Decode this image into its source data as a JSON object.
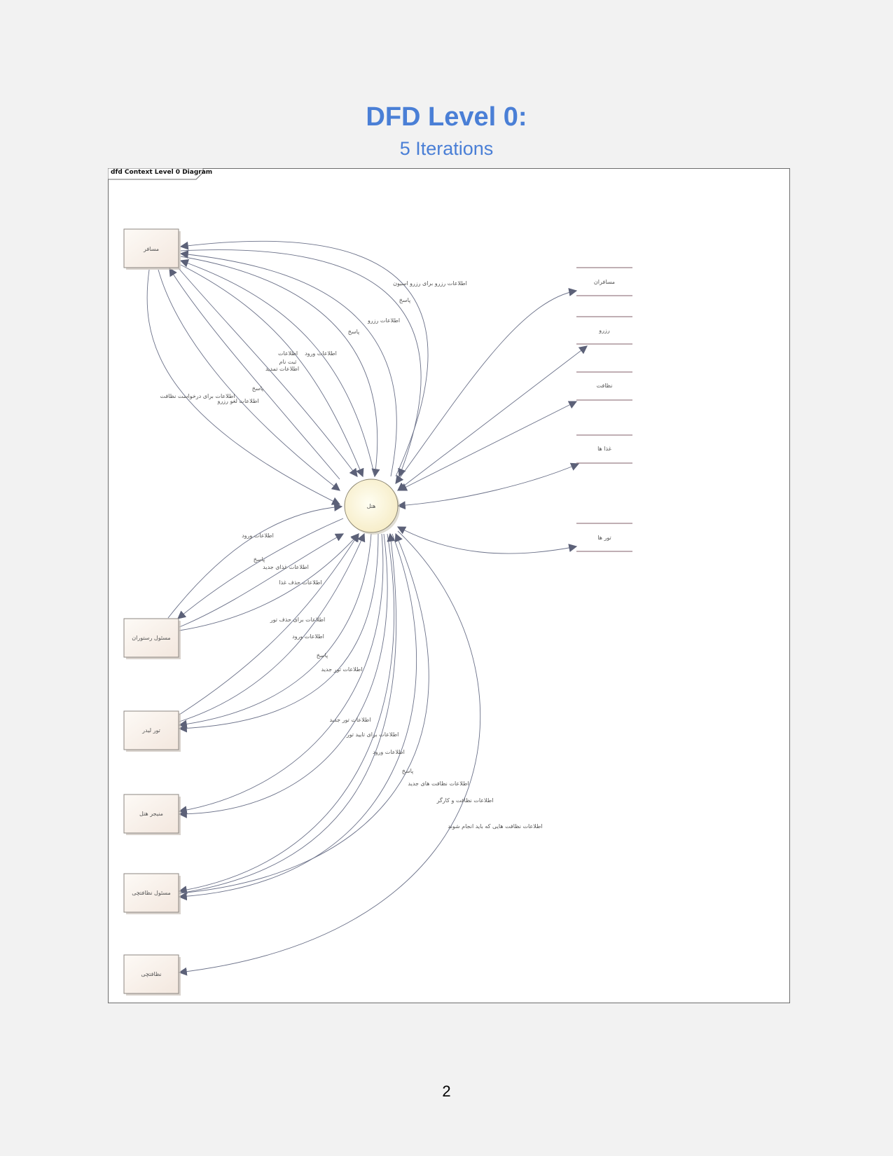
{
  "page": {
    "title": "DFD Level 0:",
    "subtitle": "5 Iterations",
    "page_number": "2"
  },
  "frame": {
    "label": "dfd Context Level 0 Diagram"
  },
  "process": {
    "label": "هتل"
  },
  "entities": [
    {
      "id": "traveler",
      "label": "مسافر"
    },
    {
      "id": "restaurant",
      "label": "مسئول رستوران"
    },
    {
      "id": "tourleader",
      "label": "تور لیدر"
    },
    {
      "id": "manager",
      "label": "منیجر هتل"
    },
    {
      "id": "cleanlead",
      "label": "مسئول نظافتچی"
    },
    {
      "id": "cleaner",
      "label": "نظافتچی"
    }
  ],
  "stores": [
    {
      "id": "travelers",
      "label": "مسافران"
    },
    {
      "id": "reserve",
      "label": "رزرو"
    },
    {
      "id": "cleaning",
      "label": "نظافت"
    },
    {
      "id": "foods",
      "label": "غذا ها"
    },
    {
      "id": "tours",
      "label": "تور ها"
    }
  ],
  "flow_labels": [
    {
      "id": "f1",
      "text": "اطلاعات رزرو برای رزرو اسیون"
    },
    {
      "id": "f2",
      "text": "پاسخ"
    },
    {
      "id": "f3",
      "text": "اطلاعات رزرو"
    },
    {
      "id": "f4",
      "text": "پاسخ"
    },
    {
      "id": "f5",
      "text": "اطلاعات ورود"
    },
    {
      "id": "f6a",
      "text": "اطلاعات"
    },
    {
      "id": "f6b",
      "text": "ثبت نام"
    },
    {
      "id": "f6c",
      "text": "اطلاعات تمدید"
    },
    {
      "id": "f7",
      "text": "پاسخ"
    },
    {
      "id": "f8",
      "text": "اطلاعات برای درخواست نظافت"
    },
    {
      "id": "f9",
      "text": "اطلاعات لغو رزرو"
    },
    {
      "id": "f10",
      "text": "اطلاعات ورود"
    },
    {
      "id": "f11",
      "text": "پاسخ"
    },
    {
      "id": "f12",
      "text": "اطلاعات غذای جدید"
    },
    {
      "id": "f13",
      "text": "اطلاعات حذف غذا"
    },
    {
      "id": "f14",
      "text": "اطلاعات برای حذف تور"
    },
    {
      "id": "f15",
      "text": "اطلاعات ورود"
    },
    {
      "id": "f16",
      "text": "پاسخ"
    },
    {
      "id": "f17",
      "text": "اطلاعات تور جدید"
    },
    {
      "id": "f18",
      "text": "اطلاعات تور جدید"
    },
    {
      "id": "f19",
      "text": "اطلاعات برای تایید تور"
    },
    {
      "id": "f20",
      "text": "اطلاعات ورود"
    },
    {
      "id": "f21",
      "text": "پاسخ"
    },
    {
      "id": "f22",
      "text": "اطلاعات نظافت های جدید"
    },
    {
      "id": "f23",
      "text": "اطلاعات نظافت و کارگر"
    },
    {
      "id": "f24",
      "text": "اطلاعات نظافت هایی که باید انجام شوند"
    }
  ]
}
